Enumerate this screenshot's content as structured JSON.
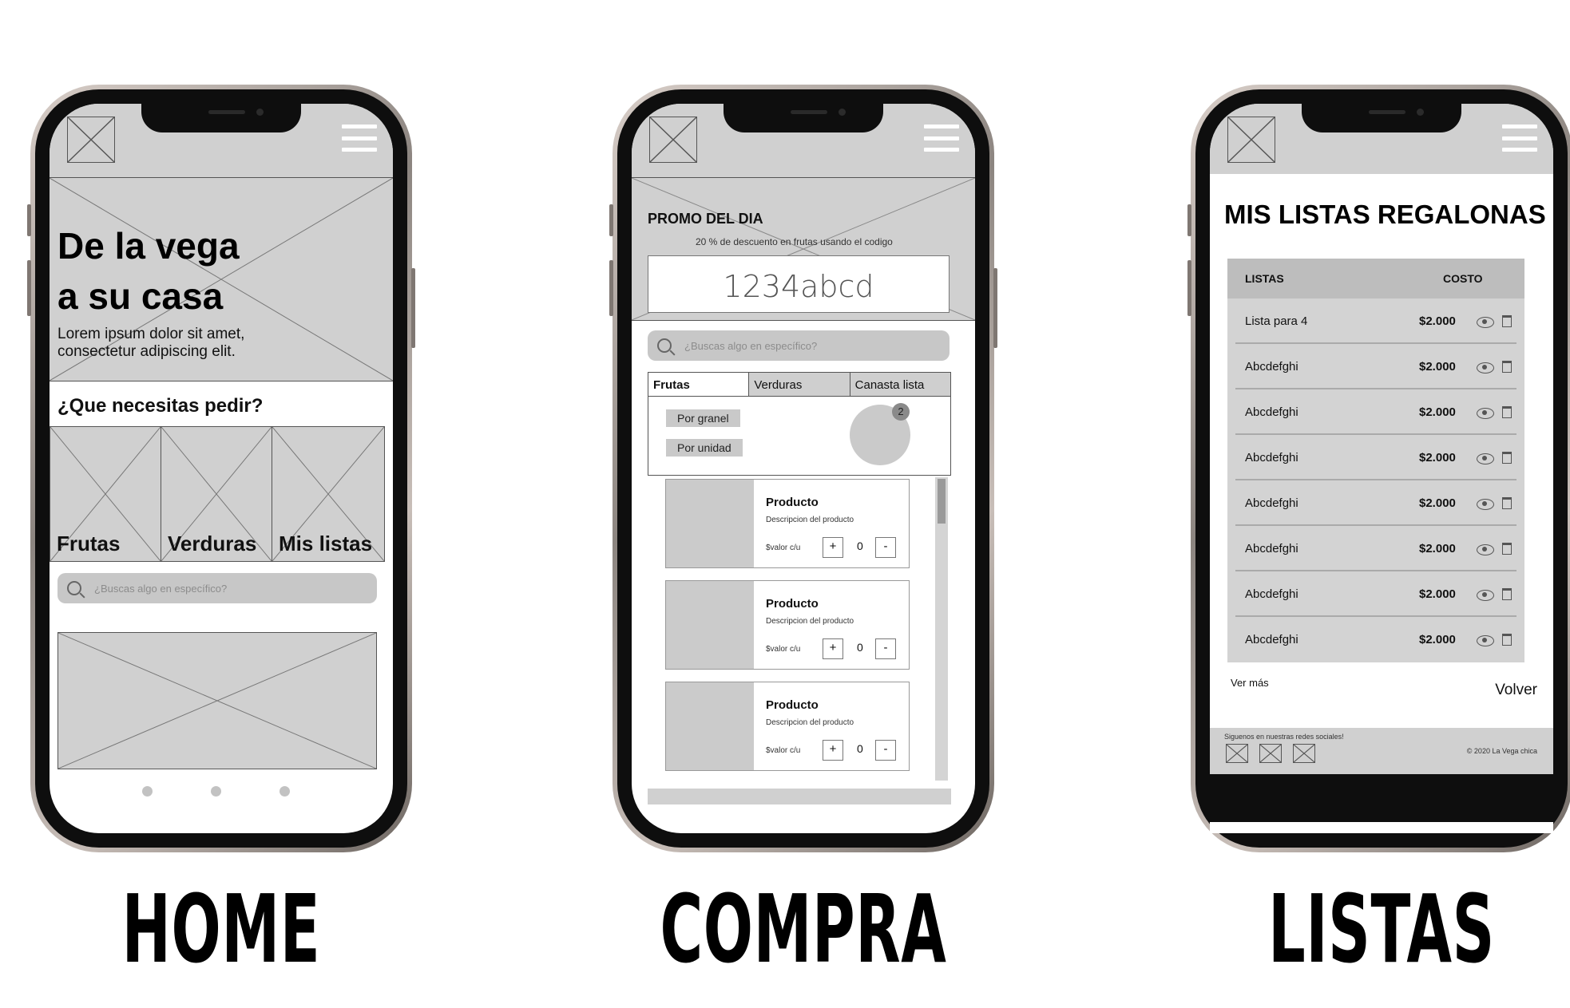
{
  "home": {
    "hero_line1": "De la vega",
    "hero_line2": "a su casa",
    "hero_sub_line1": "Lorem ipsum dolor sit amet,",
    "hero_sub_line2": "consectetur adipiscing elit.",
    "question": "¿Que necesitas pedir?",
    "categories": [
      "Frutas",
      "Verduras",
      "Mis listas"
    ],
    "search_placeholder": "¿Buscas algo en específico?",
    "caption": "HOME"
  },
  "compra": {
    "promo_title": "PROMO DEL DIA",
    "promo_desc": "20 % de descuento en frutas usando el codigo",
    "promo_code": "1234abcd",
    "search_placeholder": "¿Buscas algo en específico?",
    "tabs": [
      "Frutas",
      "Verduras",
      "Canasta lista"
    ],
    "chips": [
      "Por granel",
      "Por unidad"
    ],
    "cart_count": "2",
    "products": [
      {
        "name": "Producto",
        "desc": "Descripcion del producto",
        "value": "$valor c/u",
        "qty": "0",
        "plus": "+",
        "minus": "-"
      },
      {
        "name": "Producto",
        "desc": "Descripcion del producto",
        "value": "$valor c/u",
        "qty": "0",
        "plus": "+",
        "minus": "-"
      },
      {
        "name": "Producto",
        "desc": "Descripcion del producto",
        "value": "$valor c/u",
        "qty": "0",
        "plus": "+",
        "minus": "-"
      }
    ],
    "caption": "COMPRA"
  },
  "listas": {
    "title": "MIS LISTAS REGALONAS",
    "col_lists": "LISTAS",
    "col_cost": "COSTO",
    "rows": [
      {
        "name": "Lista para 4",
        "price": "$2.000"
      },
      {
        "name": "Abcdefghi",
        "price": "$2.000"
      },
      {
        "name": "Abcdefghi",
        "price": "$2.000"
      },
      {
        "name": "Abcdefghi",
        "price": "$2.000"
      },
      {
        "name": "Abcdefghi",
        "price": "$2.000"
      },
      {
        "name": "Abcdefghi",
        "price": "$2.000"
      },
      {
        "name": "Abcdefghi",
        "price": "$2.000"
      },
      {
        "name": "Abcdefghi",
        "price": "$2.000"
      }
    ],
    "see_more": "Ver más",
    "back": "Volver",
    "footer_social": "Siguenos en nuestras redes sociales!",
    "footer_copy": "© 2020 La Vega chica",
    "caption": "LISTAS"
  },
  "icons": [
    "image-placeholder-icon",
    "menu-icon",
    "search-icon",
    "eye-icon",
    "trash-icon"
  ],
  "colors": {
    "wire_gray": "#d0d0d0",
    "frame": "#0e0e0e"
  }
}
